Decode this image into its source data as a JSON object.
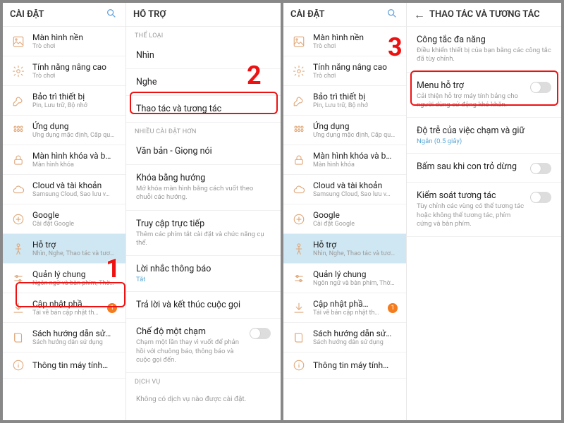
{
  "left": {
    "settings": {
      "title": "CÀI ĐẶT",
      "items": [
        {
          "icon": "wallpaper",
          "label": "Màn hình nền",
          "sub": "Trò chơi"
        },
        {
          "icon": "gear",
          "label": "Tính năng nâng cao",
          "sub": "Trò chơi"
        },
        {
          "icon": "wrench",
          "label": "Bảo trì thiết bị",
          "sub": "Pin, Lưu trữ, Bộ nhớ"
        },
        {
          "icon": "grid",
          "label": "Ứng dụng",
          "sub": "Ứng dụng mặc định, Cấp qu…"
        },
        {
          "icon": "lock",
          "label": "Màn hình khóa và b…",
          "sub": "Màn hình khóa"
        },
        {
          "icon": "cloud",
          "label": "Cloud và tài khoản",
          "sub": "Samsung Cloud, Sao lưu v…"
        },
        {
          "icon": "google",
          "label": "Google",
          "sub": "Cài đặt Google"
        },
        {
          "icon": "person",
          "label": "Hỗ trợ",
          "sub": "Nhìn, Nghe, Thao tác và tươ…",
          "selected": true
        },
        {
          "icon": "sliders",
          "label": "Quản lý chung",
          "sub": "Ngôn ngữ và bàn phím, Thờ…"
        },
        {
          "icon": "download",
          "label": "Cập nhật phầ…",
          "sub": "Tải về bản cập nhật th…",
          "badge": "1"
        },
        {
          "icon": "book",
          "label": "Sách hướng dẫn sử…",
          "sub": "Sách hướng dẫn sử dụng"
        },
        {
          "icon": "info",
          "label": "Thông tin máy tính…",
          "sub": ""
        }
      ]
    },
    "support": {
      "title": "HỖ TRỢ",
      "sections": [
        {
          "caption": "THỂ LOẠI",
          "items": [
            {
              "label": "Nhìn"
            },
            {
              "label": "Nghe"
            },
            {
              "label": "Thao tác và tương tác",
              "highlight": true
            }
          ]
        },
        {
          "caption": "NHIỀU CÀI ĐẶT HƠN",
          "items": [
            {
              "label": "Văn bản - Giọng nói"
            },
            {
              "label": "Khóa bằng hướng",
              "sub": "Mở khóa màn hình bằng cách vuốt theo chuỗi các hướng."
            },
            {
              "label": "Truy cập trực tiếp",
              "sub": "Thêm các phím tắt cài đặt và chức năng cụ thể."
            },
            {
              "label": "Lời nhắc thông báo",
              "state": "Tắt"
            },
            {
              "label": "Trả lời và kết thúc cuộc gọi"
            },
            {
              "label": "Chế độ một chạm",
              "sub": "Chạm một lần thay vì vuốt để phản hồi với chuông báo, thông báo và cuộc gọi đến.",
              "toggle": true
            }
          ]
        },
        {
          "caption": "DỊCH VỤ",
          "empty": "Không có dịch vụ nào được cài đặt."
        }
      ]
    }
  },
  "right": {
    "settings": {
      "title": "CÀI ĐẶT"
    },
    "detail": {
      "title": "THAO TÁC VÀ TƯƠNG TÁC",
      "items": [
        {
          "label": "Công tắc đa năng",
          "sub": "Điều khiển thiết bị của bạn bằng các công tắc đã tùy chỉnh."
        },
        {
          "label": "Menu hỗ trợ",
          "sub": "Cải thiện hỗ trợ máy tính bảng cho người dùng cử động khó khăn.",
          "toggle": true,
          "highlight": true
        },
        {
          "label": "Độ trễ của việc chạm và giữ",
          "state": "Ngắn (0.5 giây)"
        },
        {
          "label": "Bấm sau khi con trỏ dừng",
          "toggle": true
        },
        {
          "label": "Kiểm soát tương tác",
          "sub": "Tùy chỉnh các vùng có thể tương tác hoặc không thể tương tác, phím cứng và bàn phím.",
          "toggle": true
        }
      ]
    }
  },
  "annotations": {
    "n1": "1",
    "n2": "2",
    "n3": "3"
  }
}
